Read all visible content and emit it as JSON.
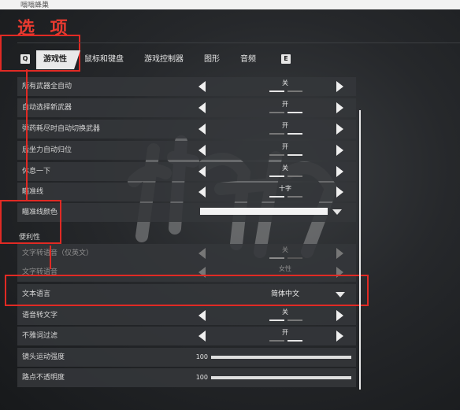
{
  "window": {
    "title": "嗡嗡蜂巢"
  },
  "heading": "选 项",
  "tabs": {
    "key_left": "Q",
    "key_right": "E",
    "items": [
      "游戏性",
      "鼠标和键盘",
      "游戏控制器",
      "图形",
      "音频"
    ],
    "active": 0
  },
  "settings": [
    {
      "label": "所有武器全自动",
      "value": "关"
    },
    {
      "label": "自动选择新武器",
      "value": "开"
    },
    {
      "label": "弹药耗尽时自动切换武器",
      "value": "开"
    },
    {
      "label": "后坐力自动归位",
      "value": "开"
    },
    {
      "label": "休息一下",
      "value": "关"
    },
    {
      "label": "瞄准线",
      "value": "十字"
    }
  ],
  "crosshair_color": {
    "label": "瞄准线颜色"
  },
  "category": "便利性",
  "accessibility": [
    {
      "label": "文字转语音（仅英文）",
      "value": "关"
    },
    {
      "label": "文字转语音",
      "value": "女性"
    }
  ],
  "text_language": {
    "label": "文本语言",
    "value": "简体中文"
  },
  "more_settings": [
    {
      "label": "语音转文字",
      "value": "关"
    },
    {
      "label": "不雅词过滤",
      "value": "开"
    }
  ],
  "sliders": [
    {
      "label": "镜头运动强度",
      "value": "100",
      "level": 1.0
    },
    {
      "label": "路点不透明度",
      "value": "100",
      "level": 1.0
    }
  ],
  "colors": {
    "highlight": "#e12a24",
    "active_tab": "#e9e9e9",
    "row_bg": "#34373a"
  }
}
